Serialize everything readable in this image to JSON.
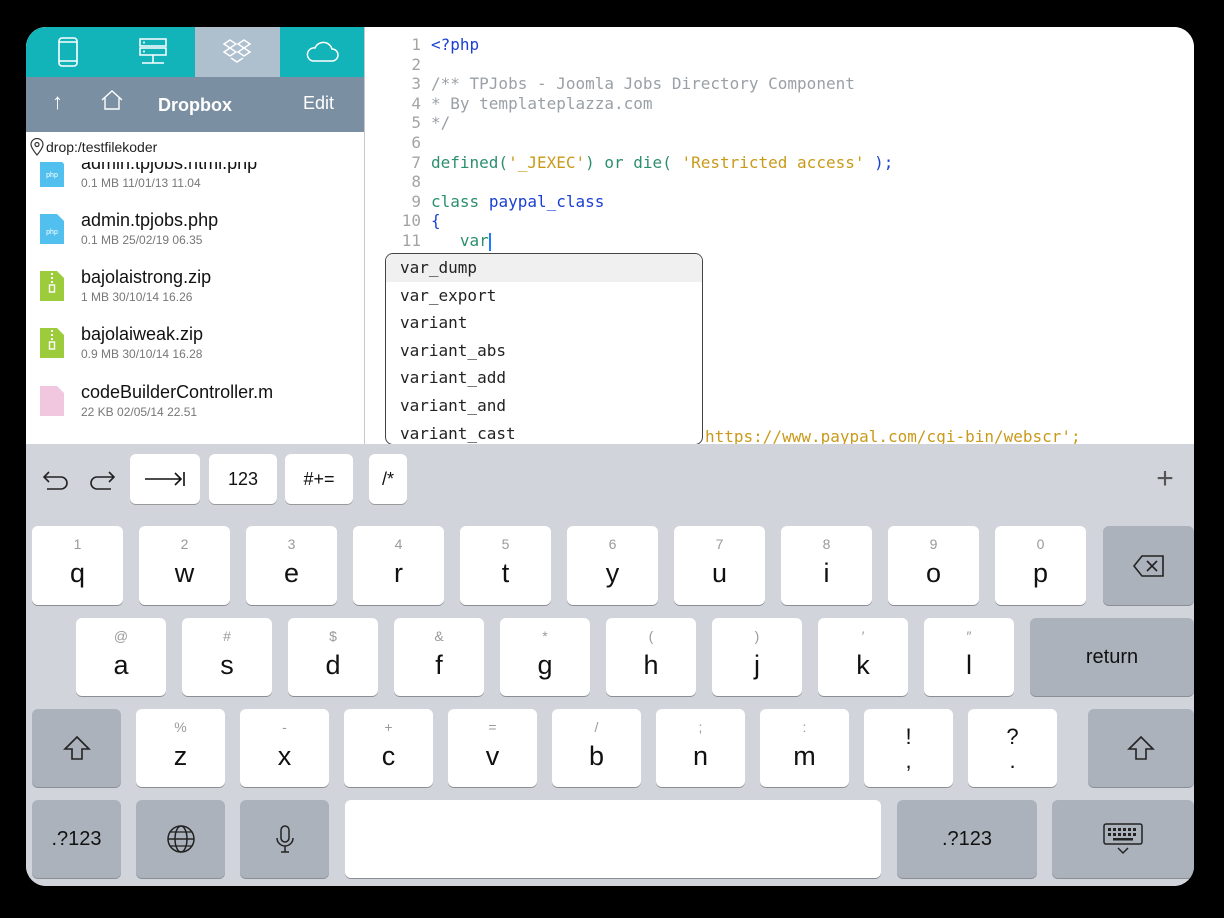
{
  "sidebar": {
    "tabs": [
      {
        "icon": "phone-icon",
        "active": false
      },
      {
        "icon": "server-icon",
        "active": false
      },
      {
        "icon": "dropbox-icon",
        "active": true
      },
      {
        "icon": "cloud-icon",
        "active": false
      }
    ],
    "nav_up": "↑",
    "title": "Dropbox",
    "edit_label": "Edit",
    "path": "drop:/testfilekoder",
    "files": [
      {
        "name": "admin.tpjobs.html.php",
        "meta": "0.1 MB 11/01/13 11.04",
        "type": "php"
      },
      {
        "name": "admin.tpjobs.php",
        "meta": "0.1 MB 25/02/19 06.35",
        "type": "php"
      },
      {
        "name": "bajolaistrong.zip",
        "meta": "1 MB 30/10/14 16.26",
        "type": "zip"
      },
      {
        "name": "bajolaiweak.zip",
        "meta": "0.9 MB 30/10/14 16.28",
        "type": "zip"
      },
      {
        "name": "codeBuilderController.m",
        "meta": "22 KB 02/05/14 22.51",
        "type": "m"
      }
    ]
  },
  "editor": {
    "line_numbers": [
      "1",
      "2",
      "3",
      "4",
      "5",
      "6",
      "7",
      "8",
      "9",
      "10",
      "11"
    ],
    "line1": "<?php",
    "line3": "/** TPJobs - Joomla Jobs Directory Component",
    "line4": "* By templateplazza.com",
    "line5": "*/",
    "line7_fn": "defined(",
    "line7_s1": "'_JEXEC'",
    "line7_mid": ") or die( ",
    "line7_s2": "'Restricted access'",
    "line7_end": " );",
    "line9_kw": "class",
    "line9_name": "paypal_class",
    "line10": "{",
    "line11_kw": "var",
    "hidden_line_tail": "https://www.paypal.com/cgi-bin/webscr';"
  },
  "autocomplete": [
    "var_dump",
    "var_export",
    "variant",
    "variant_abs",
    "variant_add",
    "variant_and",
    "variant_cast"
  ],
  "toolbar": {
    "undo_icon": "undo-icon",
    "redo_icon": "redo-icon",
    "tab_icon": "tab-arrow-icon",
    "numbers_label": "123",
    "symbols_label": "#+=",
    "comment_label": "/*",
    "add_label": "+"
  },
  "keyboard": {
    "row1": [
      {
        "main": "q",
        "alt": "1"
      },
      {
        "main": "w",
        "alt": "2"
      },
      {
        "main": "e",
        "alt": "3"
      },
      {
        "main": "r",
        "alt": "4"
      },
      {
        "main": "t",
        "alt": "5"
      },
      {
        "main": "y",
        "alt": "6"
      },
      {
        "main": "u",
        "alt": "7"
      },
      {
        "main": "i",
        "alt": "8"
      },
      {
        "main": "o",
        "alt": "9"
      },
      {
        "main": "p",
        "alt": "0"
      }
    ],
    "row2": [
      {
        "main": "a",
        "alt": "@"
      },
      {
        "main": "s",
        "alt": "#"
      },
      {
        "main": "d",
        "alt": "$"
      },
      {
        "main": "f",
        "alt": "&"
      },
      {
        "main": "g",
        "alt": "*"
      },
      {
        "main": "h",
        "alt": "("
      },
      {
        "main": "j",
        "alt": ")"
      },
      {
        "main": "k",
        "alt": "′"
      },
      {
        "main": "l",
        "alt": "″"
      }
    ],
    "row3": [
      {
        "main": "z",
        "alt": "%"
      },
      {
        "main": "x",
        "alt": "-"
      },
      {
        "main": "c",
        "alt": "+"
      },
      {
        "main": "v",
        "alt": "="
      },
      {
        "main": "b",
        "alt": "/"
      },
      {
        "main": "n",
        "alt": ";"
      },
      {
        "main": "m",
        "alt": ":"
      }
    ],
    "punct1": {
      "top": "!",
      "bottom": ","
    },
    "punct2": {
      "top": "?",
      "bottom": "."
    },
    "return_label": "return",
    "numbers_left": ".?123",
    "numbers_right": ".?123"
  }
}
